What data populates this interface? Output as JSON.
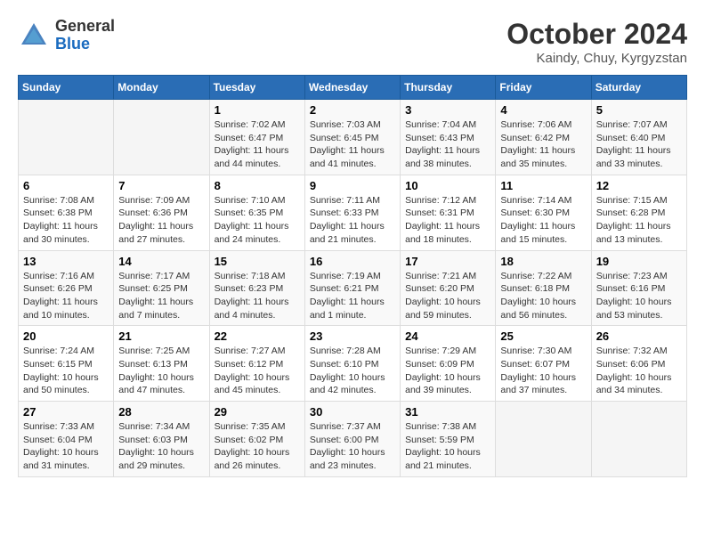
{
  "header": {
    "logo_general": "General",
    "logo_blue": "Blue",
    "month": "October 2024",
    "location": "Kaindy, Chuy, Kyrgyzstan"
  },
  "days_of_week": [
    "Sunday",
    "Monday",
    "Tuesday",
    "Wednesday",
    "Thursday",
    "Friday",
    "Saturday"
  ],
  "weeks": [
    [
      {
        "day": "",
        "info": ""
      },
      {
        "day": "",
        "info": ""
      },
      {
        "day": "1",
        "info": "Sunrise: 7:02 AM\nSunset: 6:47 PM\nDaylight: 11 hours and 44 minutes."
      },
      {
        "day": "2",
        "info": "Sunrise: 7:03 AM\nSunset: 6:45 PM\nDaylight: 11 hours and 41 minutes."
      },
      {
        "day": "3",
        "info": "Sunrise: 7:04 AM\nSunset: 6:43 PM\nDaylight: 11 hours and 38 minutes."
      },
      {
        "day": "4",
        "info": "Sunrise: 7:06 AM\nSunset: 6:42 PM\nDaylight: 11 hours and 35 minutes."
      },
      {
        "day": "5",
        "info": "Sunrise: 7:07 AM\nSunset: 6:40 PM\nDaylight: 11 hours and 33 minutes."
      }
    ],
    [
      {
        "day": "6",
        "info": "Sunrise: 7:08 AM\nSunset: 6:38 PM\nDaylight: 11 hours and 30 minutes."
      },
      {
        "day": "7",
        "info": "Sunrise: 7:09 AM\nSunset: 6:36 PM\nDaylight: 11 hours and 27 minutes."
      },
      {
        "day": "8",
        "info": "Sunrise: 7:10 AM\nSunset: 6:35 PM\nDaylight: 11 hours and 24 minutes."
      },
      {
        "day": "9",
        "info": "Sunrise: 7:11 AM\nSunset: 6:33 PM\nDaylight: 11 hours and 21 minutes."
      },
      {
        "day": "10",
        "info": "Sunrise: 7:12 AM\nSunset: 6:31 PM\nDaylight: 11 hours and 18 minutes."
      },
      {
        "day": "11",
        "info": "Sunrise: 7:14 AM\nSunset: 6:30 PM\nDaylight: 11 hours and 15 minutes."
      },
      {
        "day": "12",
        "info": "Sunrise: 7:15 AM\nSunset: 6:28 PM\nDaylight: 11 hours and 13 minutes."
      }
    ],
    [
      {
        "day": "13",
        "info": "Sunrise: 7:16 AM\nSunset: 6:26 PM\nDaylight: 11 hours and 10 minutes."
      },
      {
        "day": "14",
        "info": "Sunrise: 7:17 AM\nSunset: 6:25 PM\nDaylight: 11 hours and 7 minutes."
      },
      {
        "day": "15",
        "info": "Sunrise: 7:18 AM\nSunset: 6:23 PM\nDaylight: 11 hours and 4 minutes."
      },
      {
        "day": "16",
        "info": "Sunrise: 7:19 AM\nSunset: 6:21 PM\nDaylight: 11 hours and 1 minute."
      },
      {
        "day": "17",
        "info": "Sunrise: 7:21 AM\nSunset: 6:20 PM\nDaylight: 10 hours and 59 minutes."
      },
      {
        "day": "18",
        "info": "Sunrise: 7:22 AM\nSunset: 6:18 PM\nDaylight: 10 hours and 56 minutes."
      },
      {
        "day": "19",
        "info": "Sunrise: 7:23 AM\nSunset: 6:16 PM\nDaylight: 10 hours and 53 minutes."
      }
    ],
    [
      {
        "day": "20",
        "info": "Sunrise: 7:24 AM\nSunset: 6:15 PM\nDaylight: 10 hours and 50 minutes."
      },
      {
        "day": "21",
        "info": "Sunrise: 7:25 AM\nSunset: 6:13 PM\nDaylight: 10 hours and 47 minutes."
      },
      {
        "day": "22",
        "info": "Sunrise: 7:27 AM\nSunset: 6:12 PM\nDaylight: 10 hours and 45 minutes."
      },
      {
        "day": "23",
        "info": "Sunrise: 7:28 AM\nSunset: 6:10 PM\nDaylight: 10 hours and 42 minutes."
      },
      {
        "day": "24",
        "info": "Sunrise: 7:29 AM\nSunset: 6:09 PM\nDaylight: 10 hours and 39 minutes."
      },
      {
        "day": "25",
        "info": "Sunrise: 7:30 AM\nSunset: 6:07 PM\nDaylight: 10 hours and 37 minutes."
      },
      {
        "day": "26",
        "info": "Sunrise: 7:32 AM\nSunset: 6:06 PM\nDaylight: 10 hours and 34 minutes."
      }
    ],
    [
      {
        "day": "27",
        "info": "Sunrise: 7:33 AM\nSunset: 6:04 PM\nDaylight: 10 hours and 31 minutes."
      },
      {
        "day": "28",
        "info": "Sunrise: 7:34 AM\nSunset: 6:03 PM\nDaylight: 10 hours and 29 minutes."
      },
      {
        "day": "29",
        "info": "Sunrise: 7:35 AM\nSunset: 6:02 PM\nDaylight: 10 hours and 26 minutes."
      },
      {
        "day": "30",
        "info": "Sunrise: 7:37 AM\nSunset: 6:00 PM\nDaylight: 10 hours and 23 minutes."
      },
      {
        "day": "31",
        "info": "Sunrise: 7:38 AM\nSunset: 5:59 PM\nDaylight: 10 hours and 21 minutes."
      },
      {
        "day": "",
        "info": ""
      },
      {
        "day": "",
        "info": ""
      }
    ]
  ]
}
